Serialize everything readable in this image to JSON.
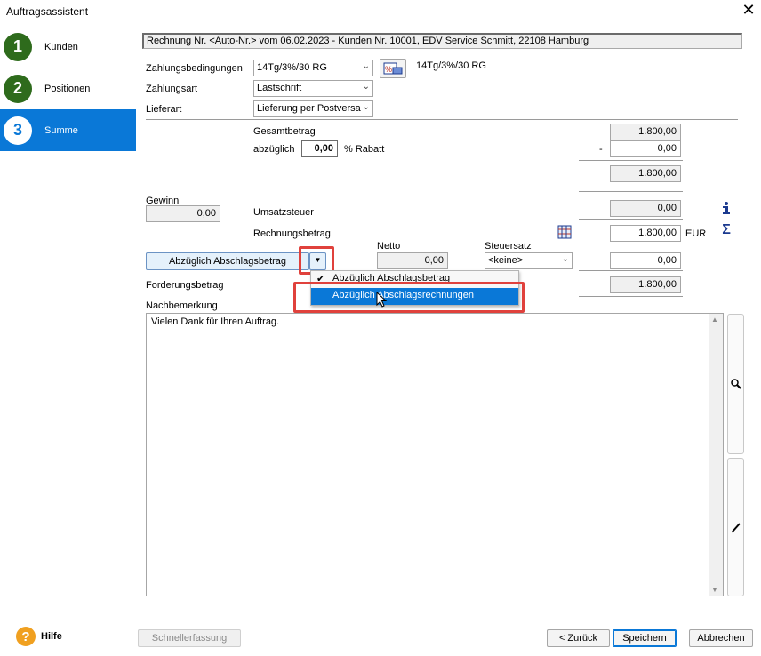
{
  "window": {
    "title": "Auftragsassistent",
    "close_glyph": "✕"
  },
  "steps": [
    {
      "number": "1",
      "label": "Kunden"
    },
    {
      "number": "2",
      "label": "Positionen"
    },
    {
      "number": "3",
      "label": "Summe"
    }
  ],
  "info_line": "Rechnung Nr. <Auto-Nr.> vom 06.02.2023 - Kunden Nr. 10001, EDV Service Schmitt, 22108 Hamburg",
  "form": {
    "zahlungsbedingungen_label": "Zahlungsbedingungen",
    "zahlungsbedingungen_value": "14Tg/3%/30 RG",
    "zahlungsbedingungen_text": "14Tg/3%/30 RG",
    "zahlungsart_label": "Zahlungsart",
    "zahlungsart_value": "Lastschrift",
    "lieferart_label": "Lieferart",
    "lieferart_value": "Lieferung per Postversa"
  },
  "totals": {
    "gesamtbetrag_label": "Gesamtbetrag",
    "gesamtbetrag_value": "1.800,00",
    "abzueglich_label": "abzüglich",
    "rabatt_percent": "0,00",
    "rabatt_label": "% Rabatt",
    "minus_sign": "-",
    "rabatt_value": "0,00",
    "subtotal_value": "1.800,00",
    "gewinn_label": "Gewinn",
    "gewinn_value": "0,00",
    "umsatzsteuer_label": "Umsatzsteuer",
    "umsatzsteuer_value": "0,00",
    "rechnungsbetrag_label": "Rechnungsbetrag",
    "rechnungsbetrag_value": "1.800,00",
    "currency": "EUR",
    "netto_label": "Netto",
    "netto_value": "0,00",
    "steuersatz_label": "Steuersatz",
    "steuersatz_value": "<keine>",
    "abschlag_value": "0,00",
    "forderungsbetrag_label": "Forderungsbetrag",
    "forderungsbetrag_value": "1.800,00"
  },
  "abschlag_button": {
    "label": "Abzüglich Abschlagsbetrag"
  },
  "dropdown_menu": {
    "items": [
      {
        "label": "Abzüglich Abschlagsbetrag",
        "checked": true
      },
      {
        "label": "Abzüglich Abschlagsrechnungen",
        "checked": false
      }
    ],
    "check_glyph": "✔"
  },
  "nachbemerkung": {
    "label": "Nachbemerkung",
    "text": "Vielen Dank für Ihren Auftrag."
  },
  "footer": {
    "help_glyph": "?",
    "help_label": "Hilfe",
    "schnellerfassung_label": "Schnellerfassung",
    "back_label": "< Zurück",
    "save_label": "Speichern",
    "cancel_label": "Abbrechen"
  },
  "icons": {
    "info": "info-icon",
    "sum": "sigma-icon",
    "calculator": "calculator-icon",
    "terms": "payment-terms-icon",
    "zoom": "magnifier-icon",
    "edit": "pencil-icon"
  },
  "colors": {
    "accent": "#0a78d7",
    "step_green": "#2e6b1c",
    "highlight_red": "#e0413c"
  }
}
